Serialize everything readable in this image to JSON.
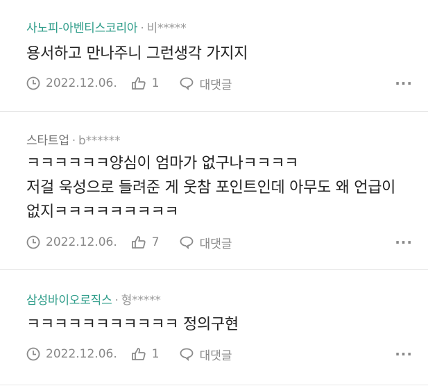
{
  "comments": [
    {
      "company": "사노피-아벤티스코리아",
      "separator": "·",
      "user": "비*****",
      "text_lines": [
        "용서하고 만나주니 그런생각 가지지"
      ],
      "date": "2022.12.06.",
      "likes": "1",
      "reply_label": "대댓글",
      "more": "···",
      "company_color": "#2f9d8a"
    },
    {
      "company": "스타트업",
      "separator": "·",
      "user": "b******",
      "text_lines": [
        "ㅋㅋㅋㅋㅋㅋ양심이 엄마가 없구나ㅋㅋㅋㅋ",
        "저걸 욱성으로 들려준 게 웃참 포인트인데 아무도 왜 언급이",
        "없지ㅋㅋㅋㅋㅋㅋㅋㅋㅋ"
      ],
      "date": "2022.12.06.",
      "likes": "7",
      "reply_label": "대댓글",
      "more": "···",
      "company_color": "#777777"
    },
    {
      "company": "삼성바이오로직스",
      "separator": "·",
      "user": "형*****",
      "text_lines": [
        "ㅋㅋㅋㅋㅋㅋㅋㅋㅋㅋㅋ 정의구현"
      ],
      "date": "2022.12.06.",
      "likes": "1",
      "reply_label": "대댓글",
      "more": "···",
      "company_color": "#2f9d8a"
    }
  ],
  "icons": {
    "date": "clock-icon",
    "likes": "thumbs-up-icon",
    "reply": "speech-bubble-icon",
    "more": "more-dots-icon"
  }
}
